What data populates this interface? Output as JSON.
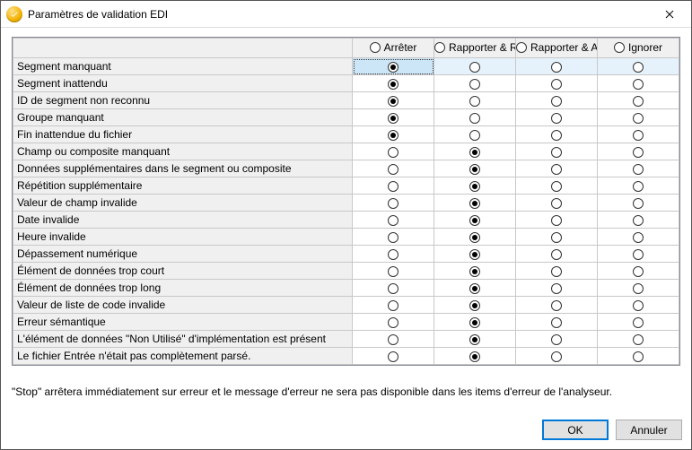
{
  "window": {
    "title": "Paramètres de validation EDI"
  },
  "columns": [
    {
      "id": "stop",
      "label": "Arrêter"
    },
    {
      "id": "report_reject",
      "label": "Rapporter & Rejeter"
    },
    {
      "id": "report_accept",
      "label": "Rapporter & Accepter"
    },
    {
      "id": "ignore",
      "label": "Ignorer"
    }
  ],
  "rows": [
    {
      "label": "Segment manquant",
      "selected": "stop",
      "highlight": true,
      "focused": true
    },
    {
      "label": "Segment inattendu",
      "selected": "stop"
    },
    {
      "label": "ID de segment non reconnu",
      "selected": "stop"
    },
    {
      "label": "Groupe manquant",
      "selected": "stop"
    },
    {
      "label": "Fin inattendue du fichier",
      "selected": "stop"
    },
    {
      "label": "Champ ou composite manquant",
      "selected": "report_reject"
    },
    {
      "label": "Données supplémentaires dans le segment ou composite",
      "selected": "report_reject"
    },
    {
      "label": "Répétition supplémentaire",
      "selected": "report_reject"
    },
    {
      "label": "Valeur de champ invalide",
      "selected": "report_reject"
    },
    {
      "label": "Date invalide",
      "selected": "report_reject"
    },
    {
      "label": "Heure invalide",
      "selected": "report_reject"
    },
    {
      "label": "Dépassement numérique",
      "selected": "report_reject"
    },
    {
      "label": "Élément de données trop court",
      "selected": "report_reject"
    },
    {
      "label": "Élément de données trop long",
      "selected": "report_reject"
    },
    {
      "label": "Valeur de liste de code invalide",
      "selected": "report_reject"
    },
    {
      "label": "Erreur sémantique",
      "selected": "report_reject"
    },
    {
      "label": "L'élément de données \"Non Utilisé\" d'implémentation est présent",
      "selected": "report_reject"
    },
    {
      "label": "Le fichier Entrée n'était pas complètement parsé.",
      "selected": "report_reject"
    }
  ],
  "hint": "\"Stop\" arrêtera immédiatement sur erreur et le message d'erreur ne sera pas disponible dans les items d'erreur de l'analyseur.",
  "buttons": {
    "ok": "OK",
    "cancel": "Annuler"
  }
}
